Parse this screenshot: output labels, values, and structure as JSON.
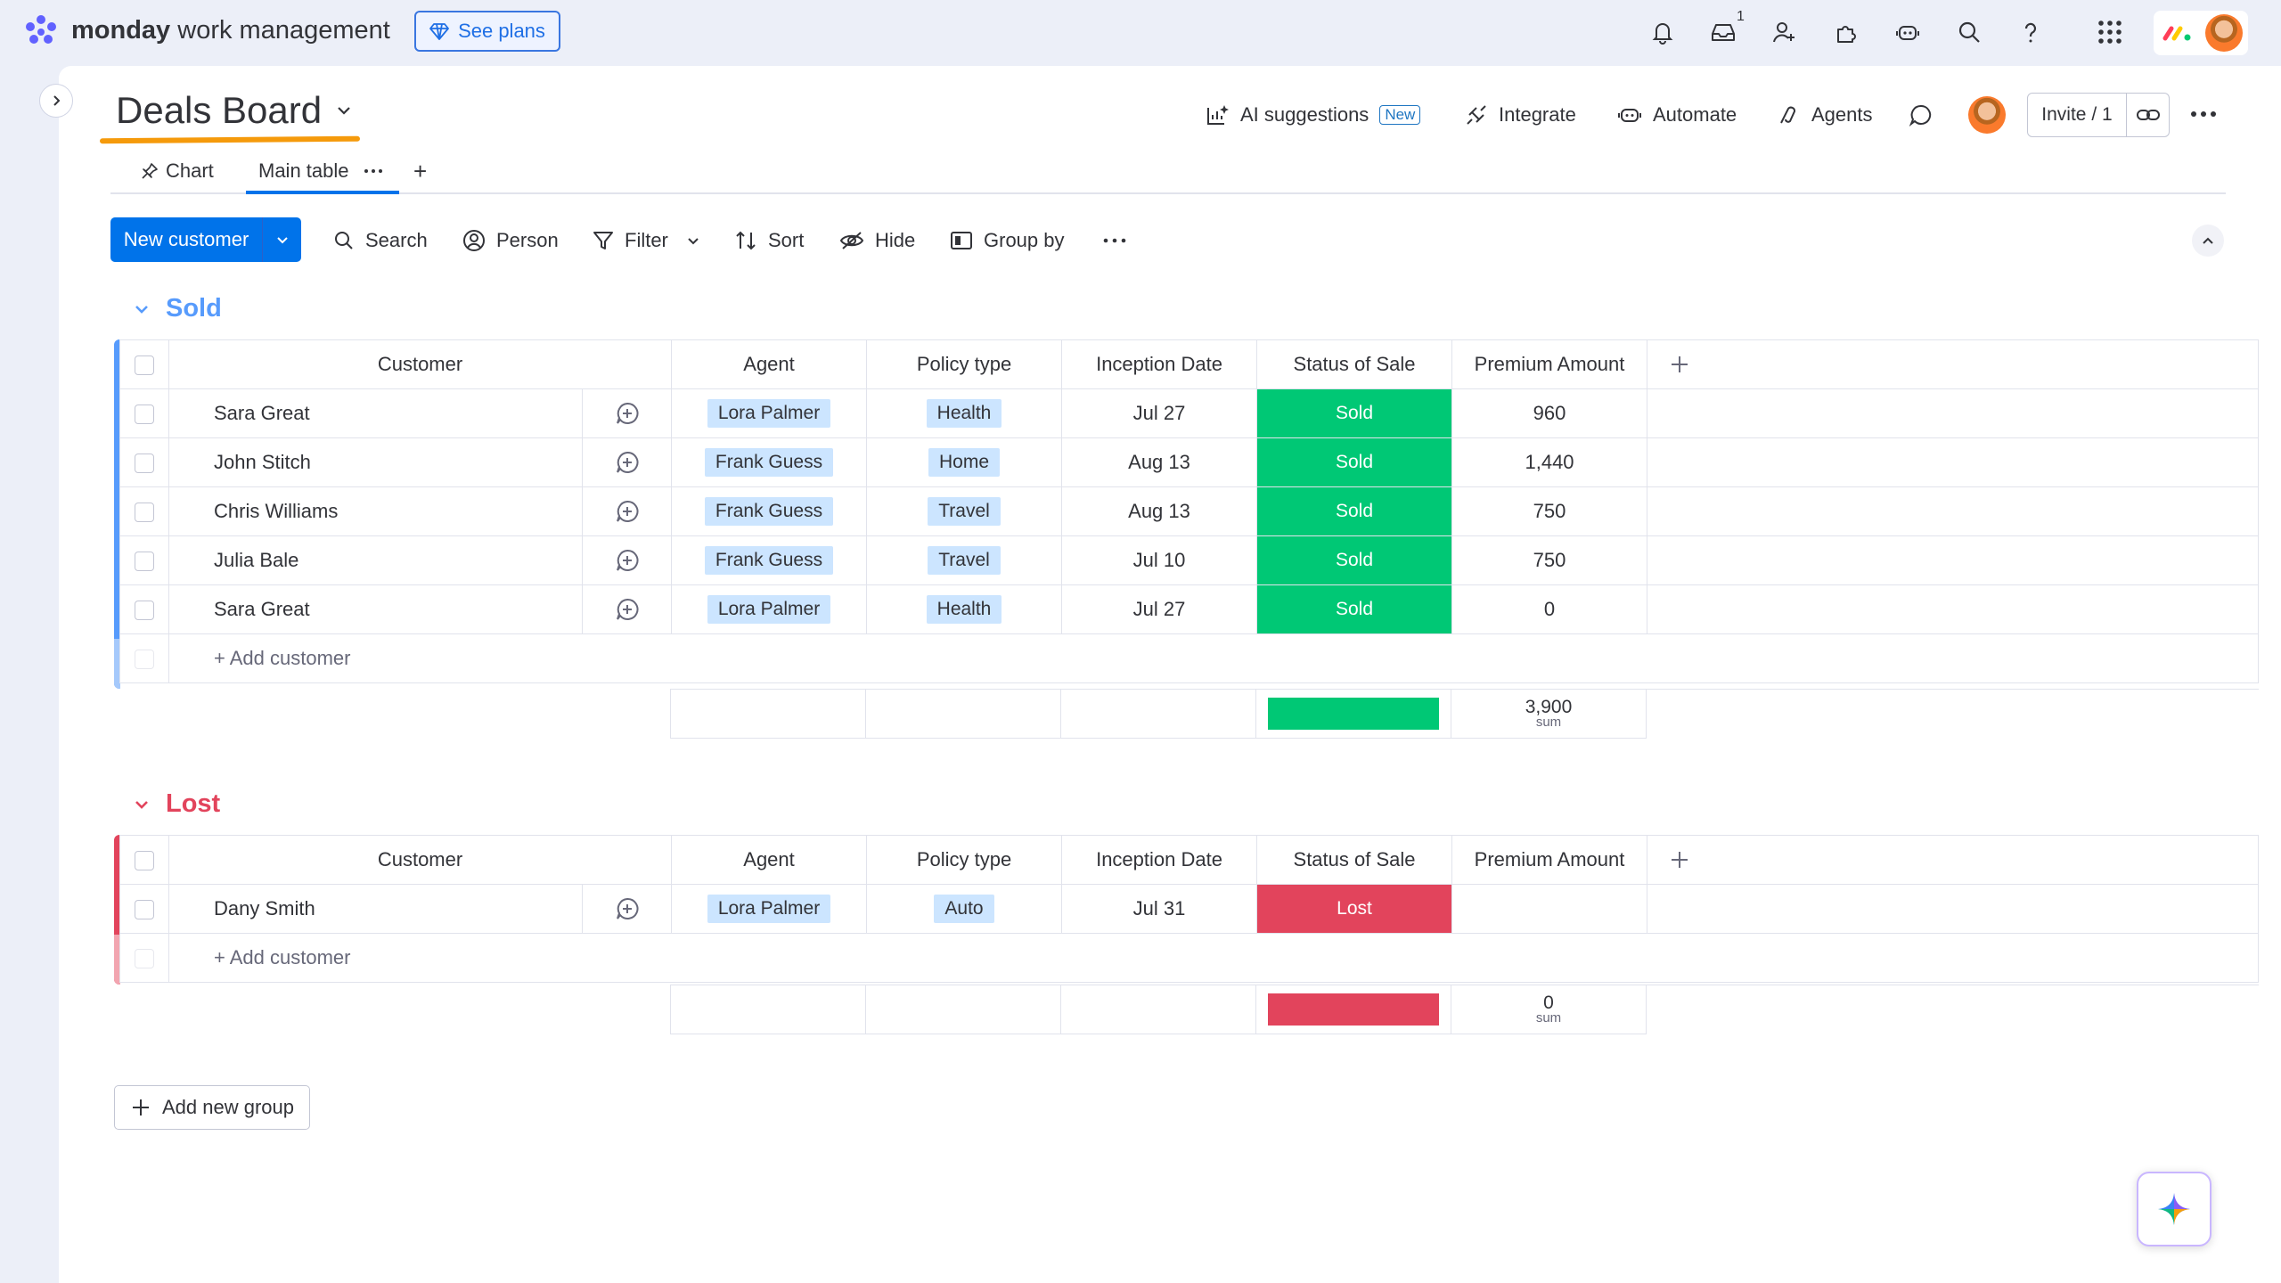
{
  "topbar": {
    "brand_bold": "monday",
    "brand_rest": " work management",
    "see_plans": "See plans",
    "inbox_badge": "1",
    "icons": [
      "bell-icon",
      "inbox-icon",
      "invite-user-icon",
      "apps-icon",
      "robot-icon",
      "search-icon",
      "help-icon",
      "grid-menu-icon",
      "monday-logo-icon",
      "user-avatar"
    ]
  },
  "board": {
    "title": "Deals Board",
    "actions": {
      "ai_suggestions": "AI suggestions",
      "new_tag": "New",
      "integrate": "Integrate",
      "automate": "Automate",
      "agents": "Agents",
      "invite": "Invite / 1"
    },
    "tabs": {
      "chart": "Chart",
      "main_table": "Main table",
      "add": "+"
    }
  },
  "toolbar": {
    "new_customer": "New customer",
    "search": "Search",
    "person": "Person",
    "filter": "Filter",
    "sort": "Sort",
    "hide": "Hide",
    "group_by": "Group by"
  },
  "columns": {
    "customer": "Customer",
    "agent": "Agent",
    "policy_type": "Policy type",
    "inception_date": "Inception Date",
    "status_of_sale": "Status of Sale",
    "premium_amount": "Premium Amount"
  },
  "groups": {
    "sold": {
      "title": "Sold",
      "color": "#579bfc",
      "rows": [
        {
          "customer": "Sara Great",
          "agent": "Lora Palmer",
          "policy": "Health",
          "date": "Jul 27",
          "status": "Sold",
          "premium": "960"
        },
        {
          "customer": "John Stitch",
          "agent": "Frank Guess",
          "policy": "Home",
          "date": "Aug 13",
          "status": "Sold",
          "premium": "1,440"
        },
        {
          "customer": "Chris Williams",
          "agent": "Frank Guess",
          "policy": "Travel",
          "date": "Aug 13",
          "status": "Sold",
          "premium": "750"
        },
        {
          "customer": "Julia Bale",
          "agent": "Frank Guess",
          "policy": "Travel",
          "date": "Jul 10",
          "status": "Sold",
          "premium": "750"
        },
        {
          "customer": "Sara Great",
          "agent": "Lora Palmer",
          "policy": "Health",
          "date": "Jul 27",
          "status": "Sold",
          "premium": "0"
        }
      ],
      "add_row": "+ Add customer",
      "sum_value": "3,900",
      "sum_label": "sum",
      "status_color": "#00c875"
    },
    "lost": {
      "title": "Lost",
      "color": "#e2445c",
      "rows": [
        {
          "customer": "Dany Smith",
          "agent": "Lora Palmer",
          "policy": "Auto",
          "date": "Jul 31",
          "status": "Lost",
          "premium": ""
        }
      ],
      "add_row": "+ Add customer",
      "sum_value": "0",
      "sum_label": "sum",
      "status_color": "#e2445c"
    }
  },
  "add_group": "Add new group"
}
